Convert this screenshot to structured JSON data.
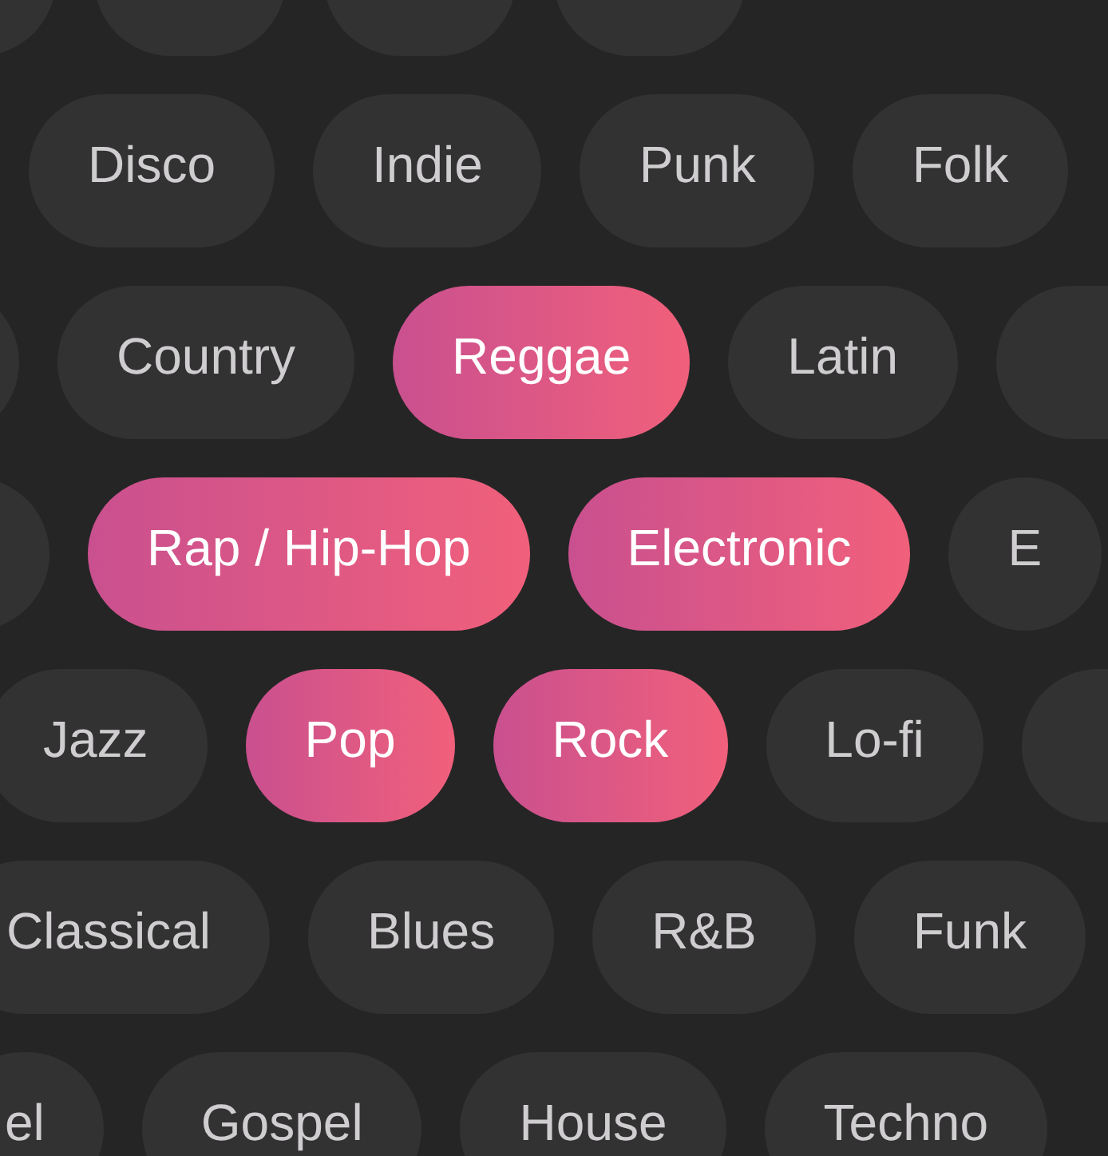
{
  "rows": [
    {
      "chips": [
        {
          "selected": false
        },
        {
          "selected": false
        },
        {
          "selected": false
        },
        {
          "selected": false
        }
      ]
    },
    {
      "chips": [
        {
          "label": "Disco",
          "selected": false
        },
        {
          "label": "Indie",
          "selected": false
        },
        {
          "label": "Punk",
          "selected": false
        },
        {
          "label": "Folk",
          "selected": false
        }
      ]
    },
    {
      "chips": [
        {
          "selected": false
        },
        {
          "label": "Country",
          "selected": false
        },
        {
          "label": "Reggae",
          "selected": true
        },
        {
          "label": "Latin",
          "selected": false
        },
        {
          "selected": false
        }
      ]
    },
    {
      "chips": [
        {
          "selected": false
        },
        {
          "label": "Rap / Hip-Hop",
          "selected": true
        },
        {
          "label": "Electronic",
          "selected": true
        },
        {
          "label": "E",
          "selected": false
        }
      ]
    },
    {
      "chips": [
        {
          "label": "Jazz",
          "selected": false
        },
        {
          "label": "Pop",
          "selected": true
        },
        {
          "label": "Rock",
          "selected": true
        },
        {
          "label": "Lo-fi",
          "selected": false
        },
        {
          "selected": false
        }
      ]
    },
    {
      "chips": [
        {
          "label": "Classical",
          "selected": false
        },
        {
          "label": "Blues",
          "selected": false
        },
        {
          "label": "R&B",
          "selected": false
        },
        {
          "label": "Funk",
          "selected": false
        }
      ]
    },
    {
      "chips": [
        {
          "label": "el",
          "selected": false
        },
        {
          "label": "Gospel",
          "selected": false
        },
        {
          "label": "House",
          "selected": false
        },
        {
          "label": "Techno",
          "selected": false
        }
      ]
    }
  ]
}
